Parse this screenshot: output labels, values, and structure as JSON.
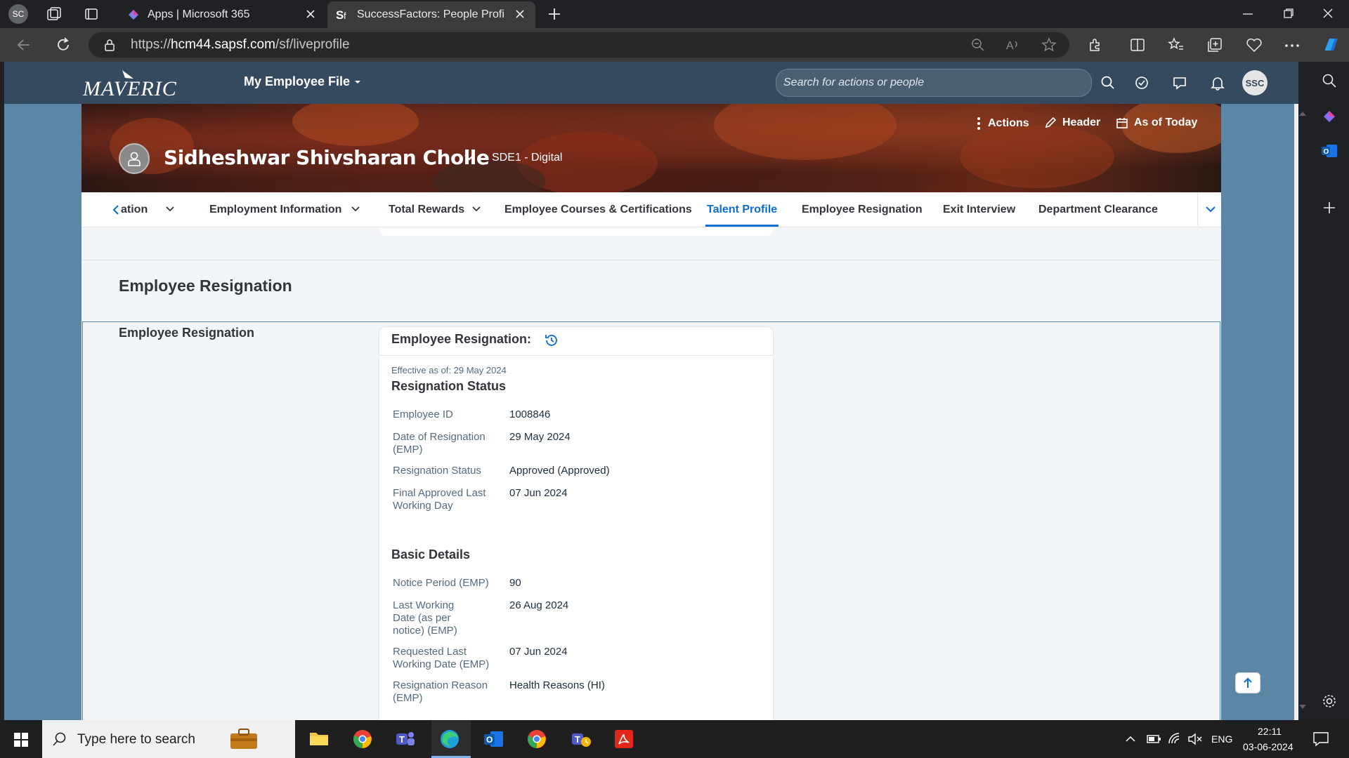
{
  "browser": {
    "profile_badge": "SC",
    "tabs": [
      {
        "title": "Apps | Microsoft 365"
      },
      {
        "title": "SuccessFactors: People Profile for"
      }
    ],
    "url_prefix": "https://",
    "url_host": "hcm44.sapsf.com",
    "url_path": "/sf/liveprofile"
  },
  "shell": {
    "logo": "MAVERIC",
    "menu_title": "My Employee File",
    "search_placeholder": "Search for actions or people",
    "avatar": "SSC"
  },
  "header": {
    "name": "Sidheshwar Shivsharan Cholle",
    "title": "SDE1 - Digital",
    "actions": [
      "Actions",
      "Header",
      "As of Today"
    ]
  },
  "nav": {
    "tabs": [
      "ation",
      "Employment Information",
      "Total Rewards",
      "Employee Courses & Certifications",
      "Talent Profile",
      "Employee Resignation",
      "Exit Interview",
      "Department Clearance"
    ],
    "active": "Talent Profile"
  },
  "section": {
    "heading": "Employee Resignation",
    "subheading": "Employee Resignation",
    "card_title": "Employee Resignation:",
    "effective": "Effective as of: 29 May 2024",
    "groups": [
      {
        "title": "Resignation Status",
        "fields": [
          {
            "label": "Employee ID",
            "value": "1008846"
          },
          {
            "label": "Date of Resignation (EMP)",
            "value": "29 May 2024"
          },
          {
            "label": "Resignation Status",
            "value": "Approved (Approved)"
          },
          {
            "label": "Final Approved Last Working Day",
            "value": "07 Jun 2024"
          }
        ]
      },
      {
        "title": "Basic Details",
        "fields": [
          {
            "label": "Notice Period (EMP)",
            "value": "90"
          },
          {
            "label": "Last Working Date (as per notice) (EMP)",
            "value": "26 Aug 2024"
          },
          {
            "label": "Requested Last Working Date (EMP)",
            "value": "07 Jun 2024"
          },
          {
            "label": "Resignation Reason (EMP)",
            "value": "Health Reasons (HI)"
          }
        ]
      }
    ]
  },
  "taskbar": {
    "search_placeholder": "Type here to search",
    "language": "ENG",
    "time": "22:11",
    "date": "03-06-2024"
  },
  "colors": {
    "shell": "#354a5f",
    "accent": "#0a6ed1",
    "page_bg": "#f3f6f9"
  }
}
